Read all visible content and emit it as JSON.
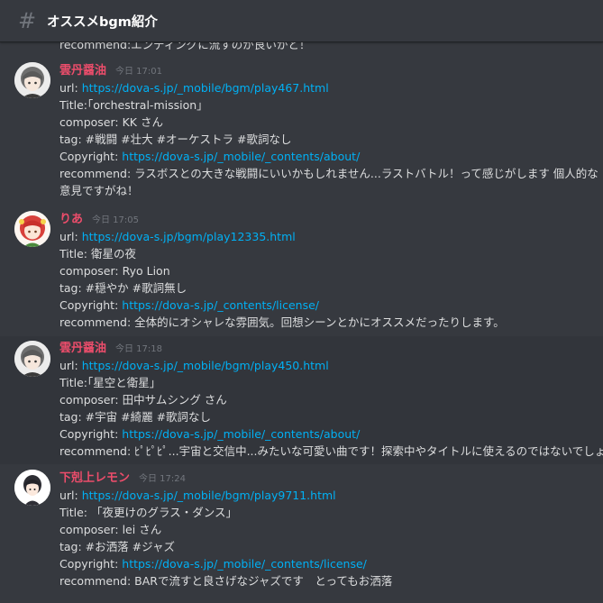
{
  "channel": {
    "title": "オススメbgm紹介",
    "icon": "hash-icon"
  },
  "cutoff_text": "recommend:エンディングに流すのが良いかと！",
  "messages": [
    {
      "author": "雲丹醤油",
      "time": "今日 17:01",
      "avatar": "gray-hair-avatar",
      "url_label": "url: ",
      "url": "https://dova-s.jp/_mobile/bgm/play467.html",
      "title_line": "Title:｢orchestral-mission｣",
      "composer": "composer: KK さん",
      "tag": "tag: #戦闘 #壮大 #オーケストラ #歌詞なし",
      "copyright_label": "Copyright: ",
      "copyright": "https://dova-s.jp/_mobile/_contents/about/",
      "recommend": "recommend: ラスボスとの大きな戦闘にいいかもしれません...ラストバトル！って感じがします 個人的な意見ですがね！"
    },
    {
      "author": "りあ",
      "time": "今日 17:05",
      "avatar": "red-hair-avatar",
      "url_label": "url: ",
      "url": "https://dova-s.jp/bgm/play12335.html",
      "title_line": "Title: 衛星の夜",
      "composer": "composer: Ryo Lion",
      "tag": "tag: #穏やか #歌詞無し",
      "copyright_label": "Copyright: ",
      "copyright": "https://dova-s.jp/_contents/license/",
      "recommend": "recommend: 全体的にオシャレな雰囲気。回想シーンとかにオススメだったりします。"
    },
    {
      "author": "雲丹醤油",
      "time": "今日 17:18",
      "avatar": "gray-hair-avatar",
      "url_label": "url: ",
      "url": "https://dova-s.jp/_mobile/bgm/play450.html",
      "title_line": "Title:｢星空と衛星｣",
      "composer": "composer: 田中サムシング さん",
      "tag": "tag: #宇宙 #綺麗 #歌詞なし",
      "copyright_label": "Copyright: ",
      "copyright": "https://dova-s.jp/_mobile/_contents/about/",
      "recommend": "recommend: ﾋﾟﾋﾟﾋﾟ...宇宙と交信中...みたいな可愛い曲です！探索中やタイトルに使えるのではないでしょうか"
    },
    {
      "author": "下剋上レモン",
      "time": "今日 17:24",
      "avatar": "dark-hair-avatar",
      "url_label": "url: ",
      "url": "https://dova-s.jp/_mobile/bgm/play9711.html",
      "title_line": "Title: 「夜更けのグラス・ダンス」",
      "composer": "composer: lei さん",
      "tag": "tag: #お洒落 #ジャズ",
      "copyright_label": "Copyright: ",
      "copyright": "https://dova-s.jp/_mobile/_contents/license/",
      "recommend": "recommend: BARで流すと良さげなジャズです　とってもお洒落"
    }
  ]
}
